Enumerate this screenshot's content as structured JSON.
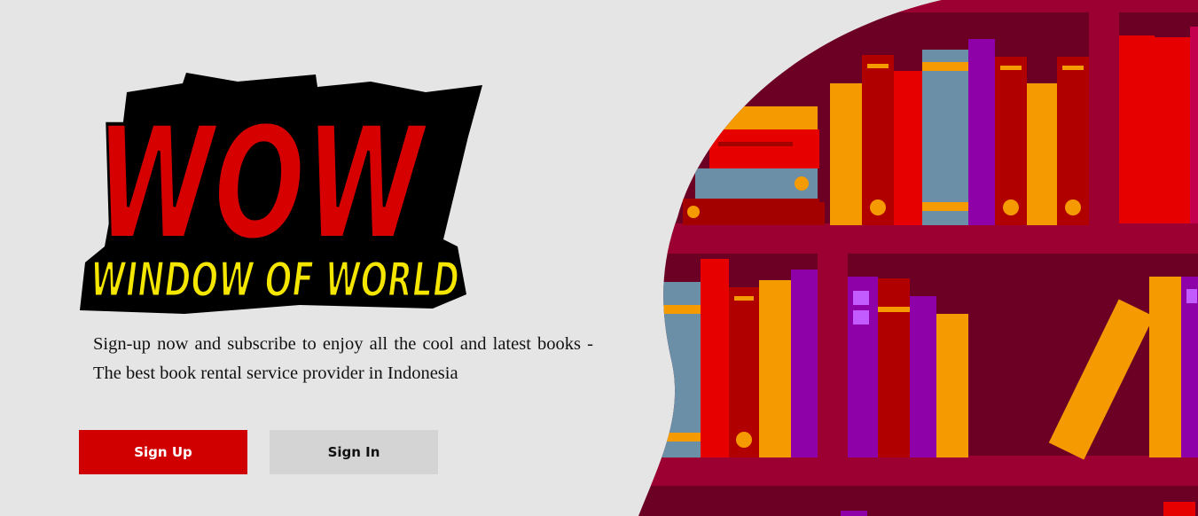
{
  "brand": {
    "logo_main": "WOW",
    "logo_sub": "WINDOW OF WORLD"
  },
  "hero": {
    "tagline": "Sign-up now and subscribe to enjoy all the cool and latest books - The best book rental service provider in Indonesia"
  },
  "actions": {
    "sign_up_label": "Sign Up",
    "sign_in_label": "Sign In"
  },
  "colors": {
    "accent_red": "#d10000",
    "logo_yellow": "#f5e600",
    "shelf_dark": "#6b0024",
    "shelf_frame": "#9c0033",
    "background": "#e5e5e5"
  },
  "icons": {
    "illustration": "bookshelf-illustration"
  }
}
